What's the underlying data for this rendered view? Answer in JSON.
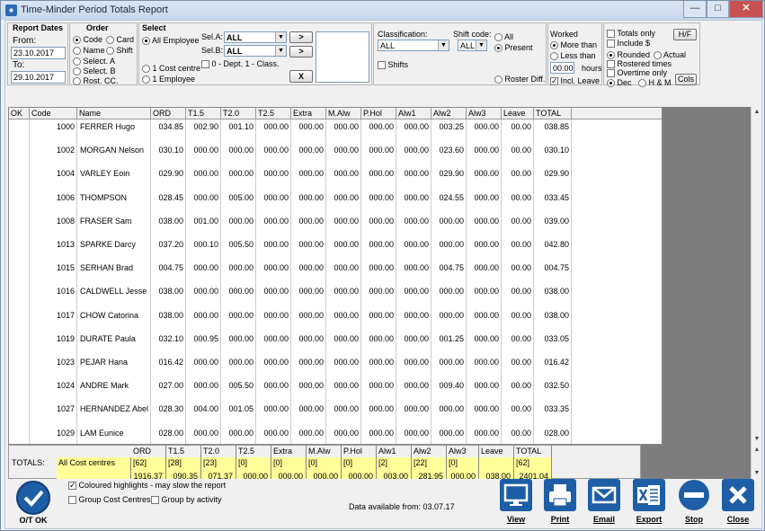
{
  "window": {
    "title": "Time-Minder Period Totals Report"
  },
  "report_dates": {
    "title": "Report Dates",
    "from_label": "From:",
    "from_value": "23.10.2017",
    "to_label": "To:",
    "to_value": "29.10.2017"
  },
  "order": {
    "title": "Order",
    "code": "Code",
    "card": "Card",
    "name": "Name",
    "shift": "Shift",
    "select_a": "Select. A",
    "select_b": "Select. B",
    "rost_cc": "Rost. CC."
  },
  "select": {
    "title": "Select",
    "all_employee": "All Employee",
    "sel_a_label": "Sel.A:",
    "sel_a_value": "ALL",
    "sel_b_label": "Sel.B:",
    "sel_b_value": "ALL",
    "btn_gt1": ">",
    "btn_gt2": ">",
    "btn_x": "X",
    "one_cost_centre": "1 Cost centre",
    "dept_class": "0 - Dept. 1 - Class.",
    "one_employee": "1 Employee"
  },
  "classification": {
    "label": "Classification:",
    "value": "ALL",
    "shift_code_label": "Shift code:",
    "shift_code_value": "ALL",
    "shifts": "Shifts",
    "all": "All",
    "present": "Present",
    "roster_diff": "Roster Diff."
  },
  "worked": {
    "title": "Worked",
    "more_than": "More than",
    "less_than": "Less than",
    "hours_value": "00.00",
    "hours_label": "hours",
    "incl_leave": "Incl. Leave"
  },
  "options": {
    "totals_only": "Totals only",
    "include_dollar": "Include $",
    "hf": "H/F",
    "rounded": "Rounded",
    "actual": "Actual",
    "rostered_times": "Rostered times",
    "overtime_only": "Overtime only",
    "dec": "Dec",
    "h_m": "H & M",
    "cols": "Cols"
  },
  "grid": {
    "columns": [
      "OK",
      "Code",
      "Name",
      "ORD",
      "T1.5",
      "T2.0",
      "T2.5",
      "Extra",
      "M.Alw",
      "P.Hol",
      "Alw1",
      "Alw2",
      "Alw3",
      "Leave",
      "TOTAL"
    ],
    "rows": [
      [
        "",
        "1000",
        "FERRER Hugo",
        "034.85",
        "002.90",
        "001.10",
        "000.00",
        "000.00",
        "000.00",
        "000.00",
        "000.00",
        "003.25",
        "000.00",
        "00.00",
        "038.85"
      ],
      [
        "",
        "1002",
        "MORGAN Nelson",
        "030.10",
        "000.00",
        "000.00",
        "000.00",
        "000.00",
        "000.00",
        "000.00",
        "000.00",
        "023.60",
        "000.00",
        "00.00",
        "030.10"
      ],
      [
        "",
        "1004",
        "VARLEY Eoin",
        "029.90",
        "000.00",
        "000.00",
        "000.00",
        "000.00",
        "000.00",
        "000.00",
        "000.00",
        "029.90",
        "000.00",
        "00.00",
        "029.90"
      ],
      [
        "",
        "1006",
        "THOMPSON",
        "028.45",
        "000.00",
        "005.00",
        "000.00",
        "000.00",
        "000.00",
        "000.00",
        "000.00",
        "024.55",
        "000.00",
        "00.00",
        "033.45"
      ],
      [
        "",
        "1008",
        "FRASER Sam",
        "038.00",
        "001.00",
        "000.00",
        "000.00",
        "000.00",
        "000.00",
        "000.00",
        "000.00",
        "000.00",
        "000.00",
        "00.00",
        "039.00"
      ],
      [
        "",
        "1013",
        "SPARKE Darcy",
        "037.20",
        "000.10",
        "005.50",
        "000.00",
        "000.00",
        "000.00",
        "000.00",
        "000.00",
        "000.00",
        "000.00",
        "00.00",
        "042.80"
      ],
      [
        "",
        "1015",
        "SERHAN Brad",
        "004.75",
        "000.00",
        "000.00",
        "000.00",
        "000.00",
        "000.00",
        "000.00",
        "000.00",
        "004.75",
        "000.00",
        "00.00",
        "004.75"
      ],
      [
        "",
        "1016",
        "CALDWELL Jesse",
        "038.00",
        "000.00",
        "000.00",
        "000.00",
        "000.00",
        "000.00",
        "000.00",
        "000.00",
        "000.00",
        "000.00",
        "00.00",
        "038.00"
      ],
      [
        "",
        "1017",
        "CHOW Catorina",
        "038.00",
        "000.00",
        "000.00",
        "000.00",
        "000.00",
        "000.00",
        "000.00",
        "000.00",
        "000.00",
        "000.00",
        "00.00",
        "038.00"
      ],
      [
        "",
        "1019",
        "DURATE Paula",
        "032.10",
        "000.95",
        "000.00",
        "000.00",
        "000.00",
        "000.00",
        "000.00",
        "000.00",
        "001.25",
        "000.00",
        "00.00",
        "033.05"
      ],
      [
        "",
        "1023",
        "PEJAR Hana",
        "016.42",
        "000.00",
        "000.00",
        "000.00",
        "000.00",
        "000.00",
        "000.00",
        "000.00",
        "000.00",
        "000.00",
        "00.00",
        "016.42"
      ],
      [
        "",
        "1024",
        "ANDRE Mark",
        "027.00",
        "000.00",
        "005.50",
        "000.00",
        "000.00",
        "000.00",
        "000.00",
        "000.00",
        "009.40",
        "000.00",
        "00.00",
        "032.50"
      ],
      [
        "",
        "1027",
        "HERNANDEZ Abel",
        "028.30",
        "004.00",
        "001.05",
        "000.00",
        "000.00",
        "000.00",
        "000.00",
        "000.00",
        "000.00",
        "000.00",
        "00.00",
        "033.35"
      ],
      [
        "",
        "1029",
        "LAM Eunice",
        "028.00",
        "000.00",
        "000.00",
        "000.00",
        "000.00",
        "000.00",
        "000.00",
        "000.00",
        "000.00",
        "000.00",
        "00.00",
        "028.00"
      ]
    ]
  },
  "totals": {
    "label": "TOTALS:",
    "group": "All Cost centres",
    "headers": [
      "ORD",
      "T1.5",
      "T2.0",
      "T2.5",
      "Extra",
      "M.Alw",
      "P.Hol",
      "Alw1",
      "Alw2",
      "Alw3",
      "Leave",
      "TOTAL"
    ],
    "counts": [
      "[62]",
      "[28]",
      "[23]",
      "[0]",
      "[0]",
      "[0]",
      "[0]",
      "[2]",
      "[22]",
      "[0]",
      "",
      "[62]"
    ],
    "values": [
      "1916.37",
      "090.35",
      "071.37",
      "000.00",
      "000.00",
      "000.00",
      "000.00",
      "003.00",
      "281.95",
      "000.00",
      "038.00",
      "2401.04"
    ]
  },
  "bottom": {
    "coloured_highlights": "Coloured highlights - may slow the report",
    "group_cost_centres": "Group Cost Centres",
    "group_by_activity": "Group by activity",
    "data_available": "Data available from:  03.07.17",
    "ok_label": "O/T OK"
  },
  "actions": {
    "view": "View",
    "print": "Print",
    "email": "Email",
    "export": "Export",
    "stop": "Stop",
    "close": "Close"
  }
}
